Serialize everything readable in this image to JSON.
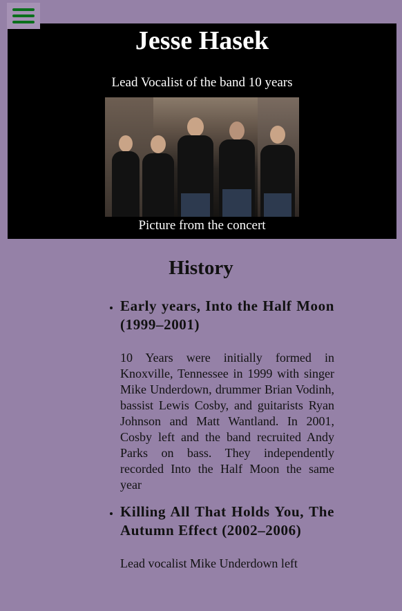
{
  "header": {
    "menu_icon": "hamburger-menu-icon",
    "menu_color": "#0b6f1c",
    "title": "Jesse Hasek",
    "subtitle": "Lead Vocalist of the band 10 years",
    "photo_caption": "Picture from the concert"
  },
  "history": {
    "title": "History",
    "eras": [
      {
        "title": "Early years, Into the Half Moon (1999–2001)",
        "text": "10 Years were initially formed in Knoxville, Tennessee in 1999 with singer Mike Underdown, drummer Brian Vodinh, bassist Lewis Cosby, and guitarists Ryan Johnson and Matt Wantland. In 2001, Cosby left and the band recruited Andy Parks on bass. They independently recorded Into the Half Moon the same year"
      },
      {
        "title": "Killing All That Holds You, The Autumn Effect (2002–2006)",
        "text": "Lead vocalist Mike Underdown left"
      }
    ]
  },
  "colors": {
    "page_background": "#9581a7",
    "hero_background": "#000000"
  }
}
